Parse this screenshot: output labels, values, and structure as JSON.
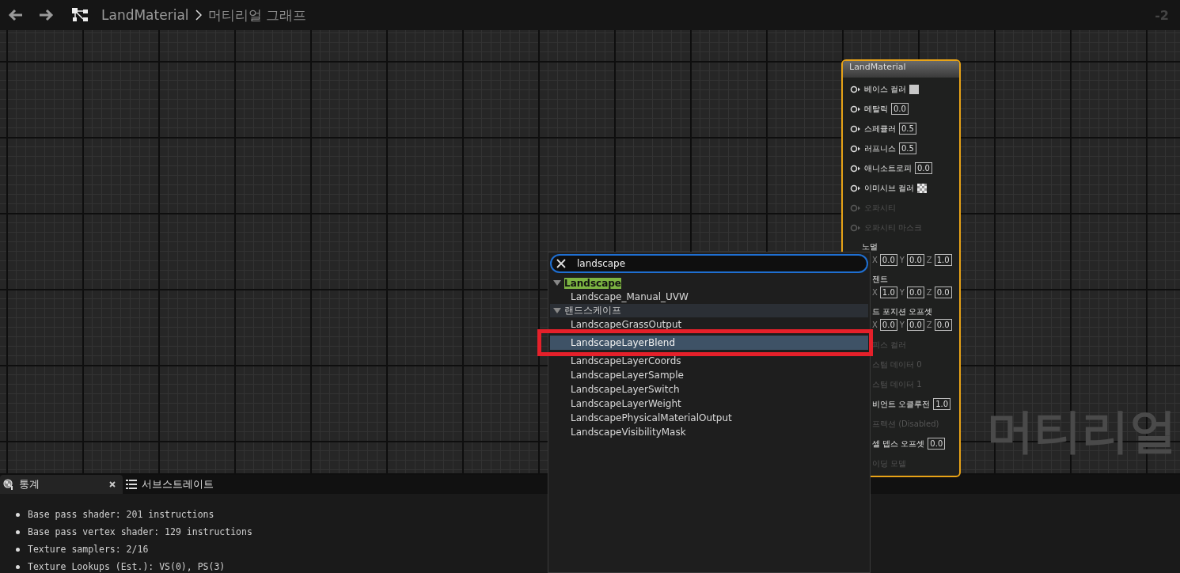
{
  "toolbar": {
    "breadcrumb": [
      {
        "label": "LandMaterial",
        "kind": "asset"
      },
      {
        "label": "머티리얼 그래프",
        "kind": "graph"
      }
    ],
    "zoom": "-2"
  },
  "graph_label": "머티리얼",
  "node": {
    "title": "LandMaterial",
    "pins": [
      {
        "label": "베이스 컬러",
        "kind": "color",
        "enabled": true,
        "clipped": false
      },
      {
        "label": "메탈릭",
        "kind": "scalar",
        "value": "0.0",
        "enabled": true,
        "clipped": false
      },
      {
        "label": "스페큘러",
        "kind": "scalar",
        "value": "0.5",
        "enabled": true,
        "clipped": false
      },
      {
        "label": "러프니스",
        "kind": "scalar",
        "value": "0.5",
        "enabled": true,
        "clipped": false
      },
      {
        "label": "애니소트로피",
        "kind": "scalar",
        "value": "0.0",
        "enabled": true,
        "clipped": false
      },
      {
        "label": "이미시브 컬러",
        "kind": "texture",
        "enabled": true,
        "clipped": false
      },
      {
        "label": "오파시티",
        "kind": "none",
        "enabled": false,
        "clipped": false
      },
      {
        "label": "오파시티 마스크",
        "kind": "none",
        "enabled": false,
        "clipped": false
      },
      {
        "label": "노멀",
        "kind": "vector",
        "values": [
          {
            "axis": "X",
            "value": "0.0"
          },
          {
            "axis": "Y",
            "value": "0.0"
          },
          {
            "axis": "Z",
            "value": "1.0"
          }
        ],
        "enabled": true,
        "clipped": false
      },
      {
        "label": "젠트",
        "kind": "vector",
        "values": [
          {
            "axis": "X",
            "value": "1.0"
          },
          {
            "axis": "Y",
            "value": "0.0"
          },
          {
            "axis": "Z",
            "value": "0.0"
          }
        ],
        "enabled": true,
        "clipped": true
      },
      {
        "label": "드 포지션 오프셋",
        "kind": "vector",
        "values": [
          {
            "axis": "X",
            "value": "0.0"
          },
          {
            "axis": "Y",
            "value": "0.0"
          },
          {
            "axis": "Z",
            "value": "0.0"
          }
        ],
        "enabled": true,
        "clipped": true
      },
      {
        "label": "피스 컬러",
        "kind": "none",
        "enabled": false,
        "clipped": true
      },
      {
        "label": "스텀 데이터 0",
        "kind": "none",
        "enabled": false,
        "clipped": true
      },
      {
        "label": "스텀 데이터 1",
        "kind": "none",
        "enabled": false,
        "clipped": true
      },
      {
        "label": "비언트 오클루전",
        "kind": "scalar",
        "value": "1.0",
        "enabled": true,
        "clipped": true
      },
      {
        "label": "프랙션 (Disabled)",
        "kind": "none",
        "enabled": false,
        "clipped": true
      },
      {
        "label": "셀 뎁스 오프셋",
        "kind": "scalar",
        "value": "0.0",
        "enabled": true,
        "clipped": true
      },
      {
        "label": "이딩 모델",
        "kind": "none",
        "enabled": false,
        "clipped": true
      }
    ]
  },
  "popup": {
    "search": "landscape",
    "categories": [
      {
        "label": "Landscape",
        "highlighted": true,
        "hovered": false,
        "expanded": true,
        "items": [
          {
            "label": "Landscape_Manual_UVW",
            "selected": false
          }
        ]
      },
      {
        "label": "랜드스케이프",
        "highlighted": false,
        "hovered": true,
        "expanded": true,
        "items": [
          {
            "label": "LandscapeGrassOutput",
            "selected": false
          },
          {
            "label": "LandscapeLayerBlend",
            "selected": true
          },
          {
            "label": "LandscapeLayerCoords",
            "selected": false
          },
          {
            "label": "LandscapeLayerSample",
            "selected": false
          },
          {
            "label": "LandscapeLayerSwitch",
            "selected": false
          },
          {
            "label": "LandscapeLayerWeight",
            "selected": false
          },
          {
            "label": "LandscapePhysicalMaterialOutput",
            "selected": false
          },
          {
            "label": "LandscapeVisibilityMask",
            "selected": false
          }
        ]
      }
    ]
  },
  "bottom_panel": {
    "tabs": [
      {
        "label": "통계",
        "kind": "stats",
        "selected": true
      },
      {
        "label": "서브스트레이트",
        "kind": "substrate",
        "selected": false
      }
    ],
    "stats": [
      "Base pass shader: 201 instructions",
      "Base pass vertex shader: 129 instructions",
      "Texture samplers: 2/16",
      "Texture Lookups (Est.): VS(0), PS(3)"
    ]
  }
}
